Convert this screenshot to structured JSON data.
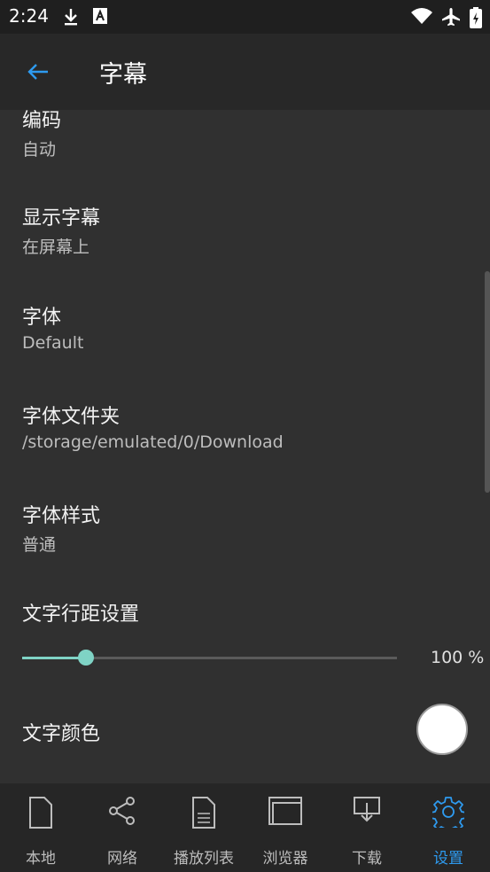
{
  "status": {
    "time": "2:24"
  },
  "header": {
    "title": "字幕",
    "back_icon": "arrow-left-icon"
  },
  "settings": {
    "encoding": {
      "title": "编码",
      "value": "自动"
    },
    "display": {
      "title": "显示字幕",
      "value": "在屏幕上"
    },
    "font": {
      "title": "字体",
      "value": "Default"
    },
    "font_folder": {
      "title": "字体文件夹",
      "value": "/storage/emulated/0/Download"
    },
    "font_style": {
      "title": "字体样式",
      "value": "普通"
    },
    "line_spacing": {
      "title": "文字行距设置",
      "value_text": "100 %",
      "fraction": 0.17
    },
    "text_color": {
      "title": "文字颜色",
      "color": "#ffffff"
    }
  },
  "nav": {
    "items": [
      {
        "label": "本地",
        "icon": "file-icon"
      },
      {
        "label": "网络",
        "icon": "share-icon"
      },
      {
        "label": "播放列表",
        "icon": "playlist-icon"
      },
      {
        "label": "浏览器",
        "icon": "browser-icon"
      },
      {
        "label": "下载",
        "icon": "download-icon"
      },
      {
        "label": "设置",
        "icon": "gear-icon"
      }
    ],
    "active_index": 5
  },
  "colors": {
    "accent": "#2e9bf0",
    "slider": "#7fd3c5",
    "background": "#303030"
  }
}
